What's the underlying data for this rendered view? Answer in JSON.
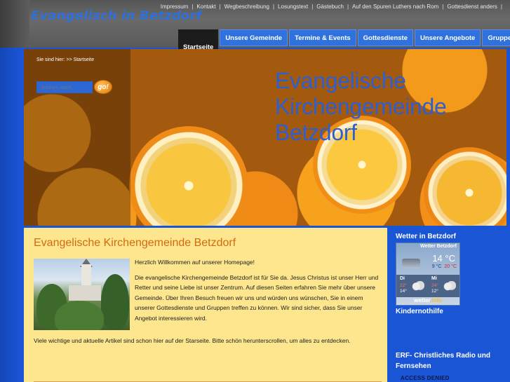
{
  "header": {
    "site_title": "Evangelisch in Betzdorf",
    "top_links": [
      "Impressum",
      "Kontakt",
      "Wegbeschreibung",
      "Losungstext",
      "Gästebuch",
      "Auf den Spuren Luthers nach Rom",
      "Gottesdienst anders"
    ],
    "separator": "|"
  },
  "main_nav": [
    {
      "label": "Startseite",
      "active": true
    },
    {
      "label": "Unsere Gemeinde",
      "active": false
    },
    {
      "label": "Termine & Events",
      "active": false
    },
    {
      "label": "Gottesdienste",
      "active": false
    },
    {
      "label": "Unsere Angebote",
      "active": false
    },
    {
      "label": "Gruppen",
      "active": false
    }
  ],
  "breadcrumb": {
    "prefix": "Sie sind hier:",
    "arrow": ">>",
    "current": "Startseite"
  },
  "search": {
    "placeholder": "Suchen nach",
    "button": "go!"
  },
  "banner": {
    "heading_line1": "Evangelische",
    "heading_line2": "Kirchengemeinde",
    "heading_line3": "Betzdorf"
  },
  "content": {
    "title": "Evangelische Kirchengemeinde Betzdorf",
    "welcome": "Herzlich Willkommen auf unserer Homepage!",
    "paragraph": "Die evangelische Kirchengemeinde Betzdorf ist für Sie da. Jesus Christus ist unser Herr und Retter und seine Liebe ist unser Zentrum. Auf diesen Seiten erfahren Sie mehr über unsere Gemeinde. Über Ihren Besuch freuen wir uns und würden uns wünschen, Sie in einem unserer Gottesdienste und Gruppen treffen zu können. Wir sind sicher, dass Sie unser Angebot interessieren wird.",
    "more": "Viele wichtige und aktuelle Artikel sind schon hier auf der Starseite. Bitte schön herunterscrollen, um alles zu entdecken."
  },
  "sidebar": {
    "weather_heading": "Wetter in Betzdorf",
    "weather": {
      "title": "Wetter Betzdorf",
      "temp": "14 °C",
      "min": "9 °C",
      "max": "20 °C",
      "days": [
        {
          "name": "Di",
          "high": "22°",
          "low": "14°"
        },
        {
          "name": "Mi",
          "high": "24°",
          "low": "12°"
        }
      ],
      "brand_a": "wetter",
      "brand_b": ".info"
    },
    "kinder_heading": "Kindernothilfe",
    "erf_heading": "ERF- Christliches Radio und Fernsehen",
    "access_denied": "ACCESS DENIED"
  },
  "colors": {
    "page_bg": "#1a55d6",
    "nav_tab": "#2f72de",
    "nav_active": "#1c1c1c",
    "content_bg": "#fde68d",
    "title_orange": "#d46a10",
    "banner_heading": "#2d5fd0"
  }
}
